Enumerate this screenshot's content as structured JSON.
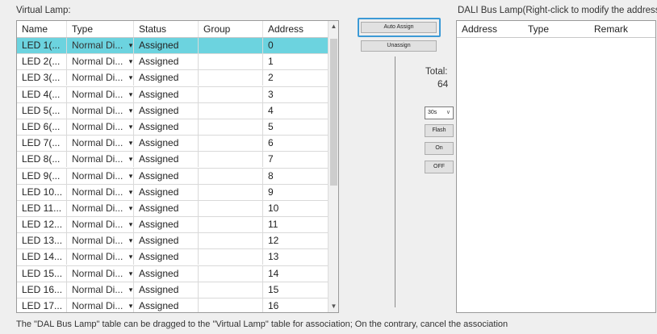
{
  "left_title": "Virtual Lamp:",
  "right_title": "DALI Bus Lamp(Right-click to modify the address)",
  "left_table": {
    "columns": [
      "Name",
      "Type",
      "Status",
      "Group",
      "Address"
    ],
    "rows": [
      {
        "name": "LED 1(...",
        "type": "Normal Di...",
        "status": "Assigned",
        "group": "",
        "address": "0"
      },
      {
        "name": "LED 2(...",
        "type": "Normal Di...",
        "status": "Assigned",
        "group": "",
        "address": "1"
      },
      {
        "name": "LED 3(...",
        "type": "Normal Di...",
        "status": "Assigned",
        "group": "",
        "address": "2"
      },
      {
        "name": "LED 4(...",
        "type": "Normal Di...",
        "status": "Assigned",
        "group": "",
        "address": "3"
      },
      {
        "name": "LED 5(...",
        "type": "Normal Di...",
        "status": "Assigned",
        "group": "",
        "address": "4"
      },
      {
        "name": "LED 6(...",
        "type": "Normal Di...",
        "status": "Assigned",
        "group": "",
        "address": "5"
      },
      {
        "name": "LED 7(...",
        "type": "Normal Di...",
        "status": "Assigned",
        "group": "",
        "address": "6"
      },
      {
        "name": "LED 8(...",
        "type": "Normal Di...",
        "status": "Assigned",
        "group": "",
        "address": "7"
      },
      {
        "name": "LED 9(...",
        "type": "Normal Di...",
        "status": "Assigned",
        "group": "",
        "address": "8"
      },
      {
        "name": "LED 10...",
        "type": "Normal Di...",
        "status": "Assigned",
        "group": "",
        "address": "9"
      },
      {
        "name": "LED 11...",
        "type": "Normal Di...",
        "status": "Assigned",
        "group": "",
        "address": "10"
      },
      {
        "name": "LED 12...",
        "type": "Normal Di...",
        "status": "Assigned",
        "group": "",
        "address": "11"
      },
      {
        "name": "LED 13...",
        "type": "Normal Di...",
        "status": "Assigned",
        "group": "",
        "address": "12"
      },
      {
        "name": "LED 14...",
        "type": "Normal Di...",
        "status": "Assigned",
        "group": "",
        "address": "13"
      },
      {
        "name": "LED 15...",
        "type": "Normal Di...",
        "status": "Assigned",
        "group": "",
        "address": "14"
      },
      {
        "name": "LED 16...",
        "type": "Normal Di...",
        "status": "Assigned",
        "group": "",
        "address": "15"
      },
      {
        "name": "LED 17...",
        "type": "Normal Di...",
        "status": "Assigned",
        "group": "",
        "address": "16"
      }
    ],
    "selected_row": 0,
    "selected_color": "#6cd3df"
  },
  "right_table": {
    "columns": [
      "Address",
      "Type",
      "Remark"
    ]
  },
  "buttons": {
    "auto_assign": "Auto Assign",
    "unassign": "Unassign",
    "flash": "Flash",
    "on": "On",
    "off": "OFF"
  },
  "interval": {
    "value": "30s"
  },
  "total": {
    "label": "Total:",
    "value": "64"
  },
  "footer": "The \"DAL Bus Lamp\" table can be dragged to the \"Virtual Lamp\" table for association;  On the contrary, cancel the association",
  "icons": {
    "dropdown": "dropdown-arrow-icon",
    "scroll_up": "scroll-up-arrow-icon",
    "scroll_down": "scroll-down-arrow-icon"
  },
  "accent": "#3c9ad6"
}
